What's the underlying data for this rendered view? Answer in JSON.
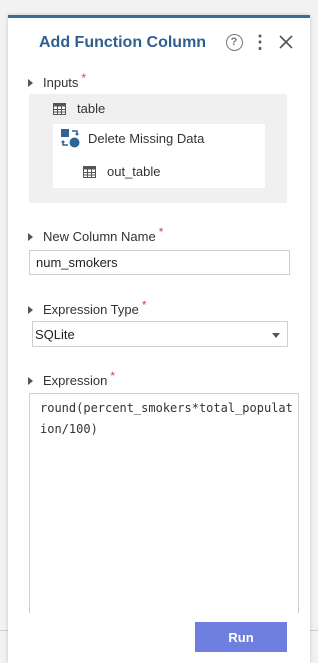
{
  "panel": {
    "title": "Add Function Column",
    "help_glyph": "?",
    "menu_glyph": "⋮"
  },
  "inputs": {
    "label": "Inputs",
    "required_mark": "*",
    "table_name": "table",
    "transform_name": "Delete Missing Data",
    "output_name": "out_table"
  },
  "column_name": {
    "label": "New Column Name",
    "required_mark": "*",
    "value": "num_smokers"
  },
  "expression_type": {
    "label": "Expression Type",
    "required_mark": "*",
    "selected": "SQLite"
  },
  "expression": {
    "label": "Expression",
    "required_mark": "*",
    "value": "round(percent_smokers*total_population/100)"
  },
  "actions": {
    "run_label": "Run"
  },
  "colors": {
    "title": "#2f5f91",
    "accent_bar": "#3b6a9b",
    "run_button": "#6e7fe0",
    "required": "#e04040",
    "transform_icon": "#2e6496"
  }
}
